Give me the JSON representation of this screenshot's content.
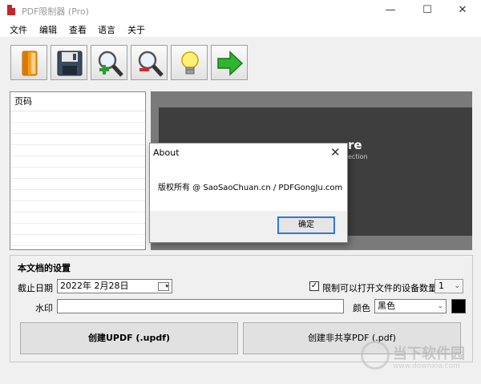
{
  "window": {
    "title": "PDF限制器 (Pro)",
    "minimize": "—",
    "maximize": "☐",
    "close": "✕"
  },
  "menu": [
    "文件",
    "编辑",
    "查看",
    "语言",
    "关于"
  ],
  "toolbar": [
    {
      "name": "open-button",
      "icon": "open-book-icon"
    },
    {
      "name": "save-button",
      "icon": "floppy-disk-icon"
    },
    {
      "name": "zoom-in-button",
      "icon": "zoom-in-icon"
    },
    {
      "name": "zoom-out-button",
      "icon": "zoom-out-icon"
    },
    {
      "name": "tip-button",
      "icon": "lightbulb-icon"
    },
    {
      "name": "next-button",
      "icon": "green-arrow-icon"
    }
  ],
  "page_list": {
    "header": "页码"
  },
  "preview": {
    "text1": "re",
    "text2": "ection"
  },
  "about_dialog": {
    "title": "About",
    "close": "✕",
    "body": "版权所有 @ SaoSaoChuan.cn / PDFGongJu.com",
    "ok": "确定"
  },
  "settings": {
    "title": "本文档的设置",
    "expiry_label": "截止日期",
    "expiry_value": "2022年  2月28日",
    "limit_devices_checked": true,
    "limit_devices_label": "限制可以打开文件的设备数量",
    "device_count": "1",
    "watermark_label": "水印",
    "watermark_value": "",
    "color_label": "颜色",
    "color_value": "黑色",
    "color_hex": "#000000",
    "create_updf": "创建UPDF (.updf)",
    "create_pdf": "创建非共享PDF (.pdf)"
  },
  "site_watermark": {
    "title": "当下软件园",
    "url": "www.downxia.com"
  }
}
